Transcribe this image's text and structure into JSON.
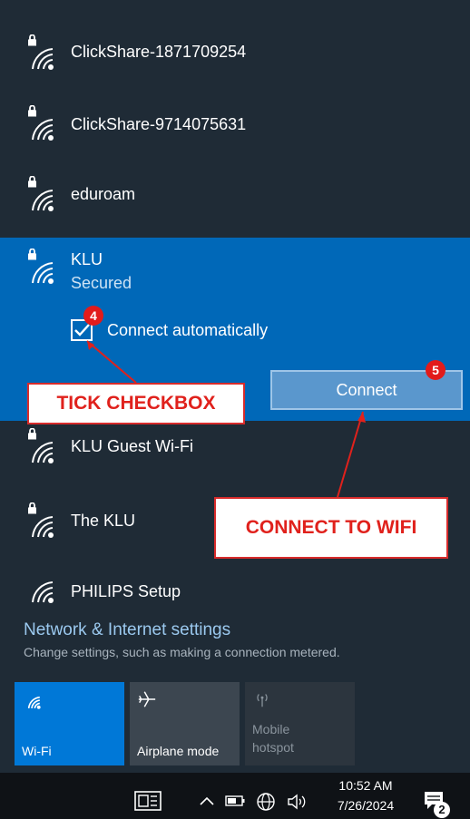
{
  "networks": [
    {
      "name": "ClickShare-1871709254",
      "secured": true
    },
    {
      "name": "ClickShare-9714075631",
      "secured": true
    },
    {
      "name": "eduroam",
      "secured": true
    },
    {
      "name": "KLU",
      "secured": true,
      "status": "Secured",
      "checkbox_label": "Connect automatically",
      "connect_label": "Connect"
    },
    {
      "name": "KLU Guest Wi-Fi",
      "secured": true
    },
    {
      "name": "The KLU",
      "secured": true
    },
    {
      "name": "PHILIPS Setup",
      "secured": false
    }
  ],
  "settings": {
    "title": "Network & Internet settings",
    "subtitle": "Change settings, such as making a connection metered."
  },
  "quick_actions": [
    {
      "label": "Wi-Fi",
      "icon": "wifi-icon",
      "state": "on"
    },
    {
      "label": "Airplane mode",
      "icon": "airplane-icon",
      "state": "off"
    },
    {
      "label_line1": "Mobile",
      "label_line2": "hotspot",
      "icon": "hotspot-icon",
      "state": "disabled"
    }
  ],
  "taskbar": {
    "time": "10:52 AM",
    "date": "7/26/2024",
    "notification_count": "2"
  },
  "annotations": {
    "tick": {
      "badge": "4",
      "label": "TICK CHECKBOX"
    },
    "connect": {
      "badge": "5",
      "label": "CONNECT TO WIFI"
    }
  },
  "colors": {
    "panel": "#1f2b36",
    "selected": "#0068b8",
    "accent_tile": "#0078d7",
    "annotation_red": "#e0211c"
  }
}
